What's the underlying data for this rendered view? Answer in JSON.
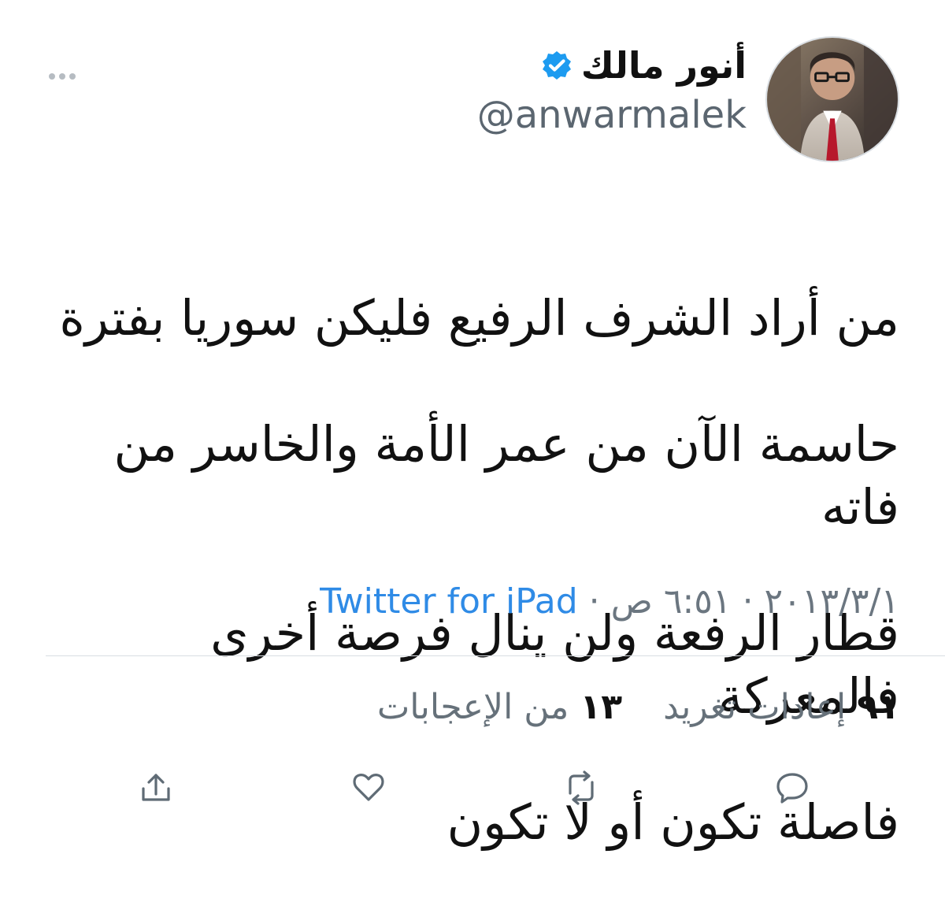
{
  "tweet": {
    "display_name": "أنور مالك",
    "handle": "@anwarmalek",
    "text_lines": [
      "من أراد الشرف الرفيع فليكن سوريا بفترة",
      "حاسمة الآن من عمر الأمة والخاسر من فاته",
      "قطار الرفعة ولن ينال فرصة أخرى فالمعركة",
      "فاصلة تكون أو لا تكون"
    ],
    "meta": {
      "date": "٢٠١٣/٣/١",
      "separator_1": " · ",
      "time": "٦:٥١ ص",
      "separator_2": " · ",
      "source": "Twitter for iPad"
    },
    "stats": {
      "retweets_count": "٩١",
      "retweets_label": "إعادات تغريد",
      "likes_count": "١٣",
      "likes_label": "من الإعجابات"
    }
  },
  "icons": {
    "verified": "verified-badge-icon",
    "more": "more-horizontal-icon",
    "reply": "reply-icon",
    "retweet": "retweet-icon",
    "like": "heart-icon",
    "share": "share-icon"
  },
  "colors": {
    "accent": "#1d9bf0",
    "secondary_text": "#66717a",
    "divider": "#d8dde2"
  }
}
